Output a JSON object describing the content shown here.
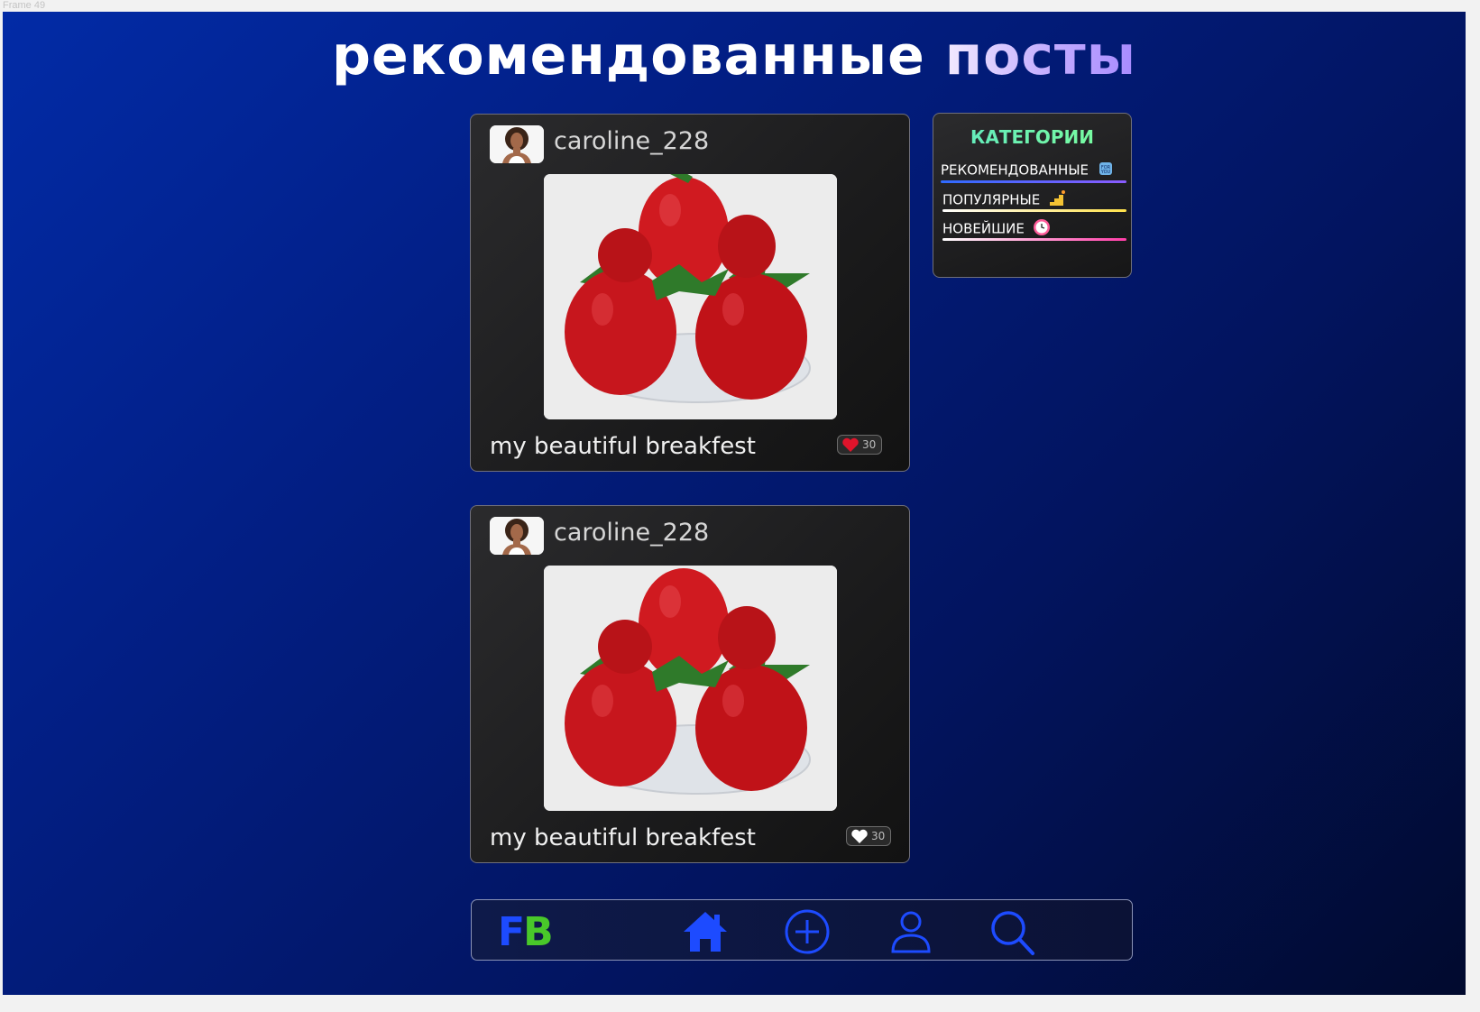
{
  "frame_label": "Frame 49",
  "title": {
    "word1": "рекомендованные",
    "word2": "посты"
  },
  "posts": [
    {
      "username": "caroline_228",
      "caption": "my beautiful breakfest",
      "likes": "30",
      "liked": true
    },
    {
      "username": "caroline_228",
      "caption": "my beautiful breakfest",
      "likes": "30",
      "liked": false
    }
  ],
  "categories": {
    "heading": "КАТЕГОРИИ",
    "items": [
      {
        "label": "РЕКОМЕНДОВАННЫЕ",
        "icon": "for-you-icon",
        "bar_colors": [
          "#2f6bff",
          "#8a5cff"
        ]
      },
      {
        "label": "ПОПУЛЯРНЫЕ",
        "icon": "stairs-icon",
        "bar_colors": [
          "#ffffff",
          "#ffe14a"
        ]
      },
      {
        "label": "НОВЕЙШИЕ",
        "icon": "clock-icon",
        "bar_colors": [
          "#ffffff",
          "#ff3da8"
        ]
      }
    ]
  },
  "nav": {
    "logo_f": "F",
    "logo_b": "B",
    "items": [
      "home-icon",
      "add-icon",
      "profile-icon",
      "search-icon"
    ]
  },
  "colors": {
    "accent_blue": "#1d4bff",
    "logo_green": "#49c82a",
    "like_red": "#e0142b"
  }
}
